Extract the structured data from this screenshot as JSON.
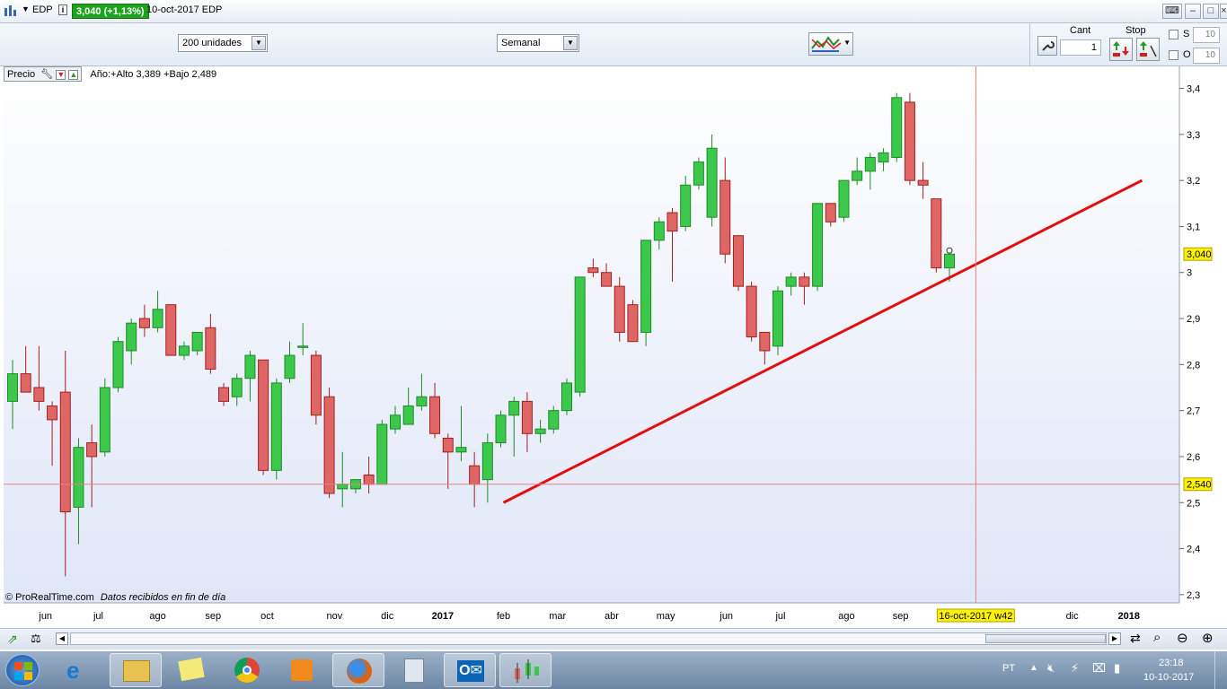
{
  "titlebar": {
    "ticker": "EDP",
    "price_change": "3,040 (+1,13%)",
    "date_ticker": "10-oct-2017 EDP"
  },
  "toolbar": {
    "units": "200 unidades",
    "period": "Semanal",
    "cant_label": "Cant",
    "cant_value": "1",
    "stop_label": "Stop",
    "s_label": "S",
    "o_label": "O",
    "s_value": "10",
    "o_value": "10"
  },
  "legend": {
    "precio": "Precio",
    "stats": "Año:+Alto 3,389 +Bajo 2,489"
  },
  "footer": {
    "credit": "© ProRealTime.com",
    "note": "Datos recibidos en fin de día"
  },
  "taskbar": {
    "lang": "PT",
    "time": "23:18",
    "date": "10-10-2017"
  },
  "colors": {
    "up": "#3cc84a",
    "down": "#e06666",
    "trendline": "#e01010",
    "crosshair": "#e88080",
    "tag": "#fff200"
  },
  "chart_data": {
    "type": "candlestick",
    "y_ticks": [
      "3,4",
      "3,3",
      "3,2",
      "3,1",
      "3",
      "2,9",
      "2,8",
      "2,7",
      "2,6",
      "2,5",
      "2,4",
      "2,3"
    ],
    "y_tick_values": [
      3.4,
      3.3,
      3.2,
      3.1,
      3.0,
      2.9,
      2.8,
      2.7,
      2.6,
      2.5,
      2.4,
      2.3
    ],
    "ylim": [
      2.29,
      3.44
    ],
    "x_labels": [
      {
        "label": "jun",
        "week": 2.5
      },
      {
        "label": "jul",
        "week": 6.5
      },
      {
        "label": "ago",
        "week": 11
      },
      {
        "label": "sep",
        "week": 15.2
      },
      {
        "label": "oct",
        "week": 19.3
      },
      {
        "label": "nov",
        "week": 24.4
      },
      {
        "label": "dic",
        "week": 28.4
      },
      {
        "label": "2017",
        "week": 32.6,
        "bold": true
      },
      {
        "label": "feb",
        "week": 37.2
      },
      {
        "label": "mar",
        "week": 41.3
      },
      {
        "label": "abr",
        "week": 45.4
      },
      {
        "label": "may",
        "week": 49.5
      },
      {
        "label": "jun",
        "week": 54.1
      },
      {
        "label": "jul",
        "week": 58.2
      },
      {
        "label": "ago",
        "week": 63.2
      },
      {
        "label": "sep",
        "week": 67.3
      },
      {
        "label": "dic",
        "week": 80.3
      },
      {
        "label": "2018",
        "week": 84.6,
        "bold": true
      }
    ],
    "cursor_date": "16-oct-2017 w42",
    "cursor_week": 73,
    "current_price": 3.04,
    "current_price_label": "3,040",
    "cursor_price": 2.54,
    "cursor_price_label": "2,540",
    "trendline": {
      "from": {
        "week": 37.2,
        "value": 2.5
      },
      "to": {
        "week": 85.6,
        "value": 3.2
      }
    },
    "candles": [
      {
        "o": 2.72,
        "h": 2.81,
        "l": 2.66,
        "c": 2.78
      },
      {
        "o": 2.78,
        "h": 2.84,
        "l": 2.74,
        "c": 2.74
      },
      {
        "o": 2.75,
        "h": 2.84,
        "l": 2.7,
        "c": 2.72
      },
      {
        "o": 2.71,
        "h": 2.72,
        "l": 2.58,
        "c": 2.68
      },
      {
        "o": 2.74,
        "h": 2.83,
        "l": 2.34,
        "c": 2.48
      },
      {
        "o": 2.49,
        "h": 2.64,
        "l": 2.41,
        "c": 2.62
      },
      {
        "o": 2.63,
        "h": 2.67,
        "l": 2.49,
        "c": 2.6
      },
      {
        "o": 2.61,
        "h": 2.77,
        "l": 2.6,
        "c": 2.75
      },
      {
        "o": 2.75,
        "h": 2.86,
        "l": 2.74,
        "c": 2.85
      },
      {
        "o": 2.83,
        "h": 2.9,
        "l": 2.8,
        "c": 2.89
      },
      {
        "o": 2.9,
        "h": 2.93,
        "l": 2.86,
        "c": 2.88
      },
      {
        "o": 2.88,
        "h": 2.96,
        "l": 2.87,
        "c": 2.92
      },
      {
        "o": 2.93,
        "h": 2.93,
        "l": 2.82,
        "c": 2.82
      },
      {
        "o": 2.82,
        "h": 2.85,
        "l": 2.81,
        "c": 2.84
      },
      {
        "o": 2.83,
        "h": 2.87,
        "l": 2.82,
        "c": 2.87
      },
      {
        "o": 2.88,
        "h": 2.91,
        "l": 2.78,
        "c": 2.79
      },
      {
        "o": 2.75,
        "h": 2.76,
        "l": 2.71,
        "c": 2.72
      },
      {
        "o": 2.73,
        "h": 2.78,
        "l": 2.71,
        "c": 2.77
      },
      {
        "o": 2.77,
        "h": 2.83,
        "l": 2.72,
        "c": 2.82
      },
      {
        "o": 2.81,
        "h": 2.81,
        "l": 2.56,
        "c": 2.57
      },
      {
        "o": 2.57,
        "h": 2.77,
        "l": 2.55,
        "c": 2.76
      },
      {
        "o": 2.77,
        "h": 2.85,
        "l": 2.76,
        "c": 2.82
      },
      {
        "o": 2.84,
        "h": 2.89,
        "l": 2.82,
        "c": 2.84
      },
      {
        "o": 2.82,
        "h": 2.83,
        "l": 2.67,
        "c": 2.69
      },
      {
        "o": 2.73,
        "h": 2.75,
        "l": 2.51,
        "c": 2.52
      },
      {
        "o": 2.53,
        "h": 2.61,
        "l": 2.49,
        "c": 2.54
      },
      {
        "o": 2.53,
        "h": 2.55,
        "l": 2.52,
        "c": 2.55
      },
      {
        "o": 2.56,
        "h": 2.6,
        "l": 2.52,
        "c": 2.54
      },
      {
        "o": 2.54,
        "h": 2.68,
        "l": 2.54,
        "c": 2.67
      },
      {
        "o": 2.66,
        "h": 2.71,
        "l": 2.65,
        "c": 2.69
      },
      {
        "o": 2.67,
        "h": 2.75,
        "l": 2.67,
        "c": 2.71
      },
      {
        "o": 2.71,
        "h": 2.78,
        "l": 2.7,
        "c": 2.73
      },
      {
        "o": 2.73,
        "h": 2.76,
        "l": 2.64,
        "c": 2.65
      },
      {
        "o": 2.64,
        "h": 2.65,
        "l": 2.53,
        "c": 2.61
      },
      {
        "o": 2.61,
        "h": 2.71,
        "l": 2.59,
        "c": 2.62
      },
      {
        "o": 2.58,
        "h": 2.61,
        "l": 2.49,
        "c": 2.54
      },
      {
        "o": 2.55,
        "h": 2.65,
        "l": 2.5,
        "c": 2.63
      },
      {
        "o": 2.63,
        "h": 2.7,
        "l": 2.62,
        "c": 2.69
      },
      {
        "o": 2.69,
        "h": 2.73,
        "l": 2.6,
        "c": 2.72
      },
      {
        "o": 2.72,
        "h": 2.74,
        "l": 2.61,
        "c": 2.65
      },
      {
        "o": 2.65,
        "h": 2.68,
        "l": 2.63,
        "c": 2.66
      },
      {
        "o": 2.66,
        "h": 2.71,
        "l": 2.65,
        "c": 2.7
      },
      {
        "o": 2.7,
        "h": 2.77,
        "l": 2.69,
        "c": 2.76
      },
      {
        "o": 2.74,
        "h": 2.99,
        "l": 2.73,
        "c": 2.99
      },
      {
        "o": 3.01,
        "h": 3.03,
        "l": 2.99,
        "c": 3.0
      },
      {
        "o": 3.0,
        "h": 3.02,
        "l": 2.97,
        "c": 2.97
      },
      {
        "o": 2.97,
        "h": 2.99,
        "l": 2.85,
        "c": 2.87
      },
      {
        "o": 2.93,
        "h": 2.94,
        "l": 2.85,
        "c": 2.85
      },
      {
        "o": 2.87,
        "h": 3.07,
        "l": 2.84,
        "c": 3.07
      },
      {
        "o": 3.07,
        "h": 3.12,
        "l": 3.05,
        "c": 3.11
      },
      {
        "o": 3.13,
        "h": 3.14,
        "l": 2.98,
        "c": 3.09
      },
      {
        "o": 3.1,
        "h": 3.21,
        "l": 3.09,
        "c": 3.19
      },
      {
        "o": 3.19,
        "h": 3.25,
        "l": 3.18,
        "c": 3.24
      },
      {
        "o": 3.12,
        "h": 3.3,
        "l": 3.1,
        "c": 3.27
      },
      {
        "o": 3.2,
        "h": 3.25,
        "l": 3.02,
        "c": 3.04
      },
      {
        "o": 3.08,
        "h": 3.08,
        "l": 2.96,
        "c": 2.97
      },
      {
        "o": 2.97,
        "h": 2.98,
        "l": 2.85,
        "c": 2.86
      },
      {
        "o": 2.87,
        "h": 2.87,
        "l": 2.8,
        "c": 2.83
      },
      {
        "o": 2.84,
        "h": 2.97,
        "l": 2.82,
        "c": 2.96
      },
      {
        "o": 2.97,
        "h": 3.0,
        "l": 2.95,
        "c": 2.99
      },
      {
        "o": 2.99,
        "h": 3.0,
        "l": 2.93,
        "c": 2.97
      },
      {
        "o": 2.97,
        "h": 3.15,
        "l": 2.96,
        "c": 3.15
      },
      {
        "o": 3.15,
        "h": 3.15,
        "l": 3.1,
        "c": 3.11
      },
      {
        "o": 3.12,
        "h": 3.2,
        "l": 3.11,
        "c": 3.2
      },
      {
        "o": 3.2,
        "h": 3.25,
        "l": 3.19,
        "c": 3.22
      },
      {
        "o": 3.22,
        "h": 3.26,
        "l": 3.18,
        "c": 3.25
      },
      {
        "o": 3.24,
        "h": 3.27,
        "l": 3.22,
        "c": 3.26
      },
      {
        "o": 3.25,
        "h": 3.39,
        "l": 3.24,
        "c": 3.38
      },
      {
        "o": 3.37,
        "h": 3.39,
        "l": 3.19,
        "c": 3.2
      },
      {
        "o": 3.2,
        "h": 3.24,
        "l": 3.16,
        "c": 3.19
      },
      {
        "o": 3.16,
        "h": 3.16,
        "l": 3.0,
        "c": 3.01
      },
      {
        "o": 3.01,
        "h": 3.04,
        "l": 2.98,
        "c": 3.04
      }
    ]
  }
}
